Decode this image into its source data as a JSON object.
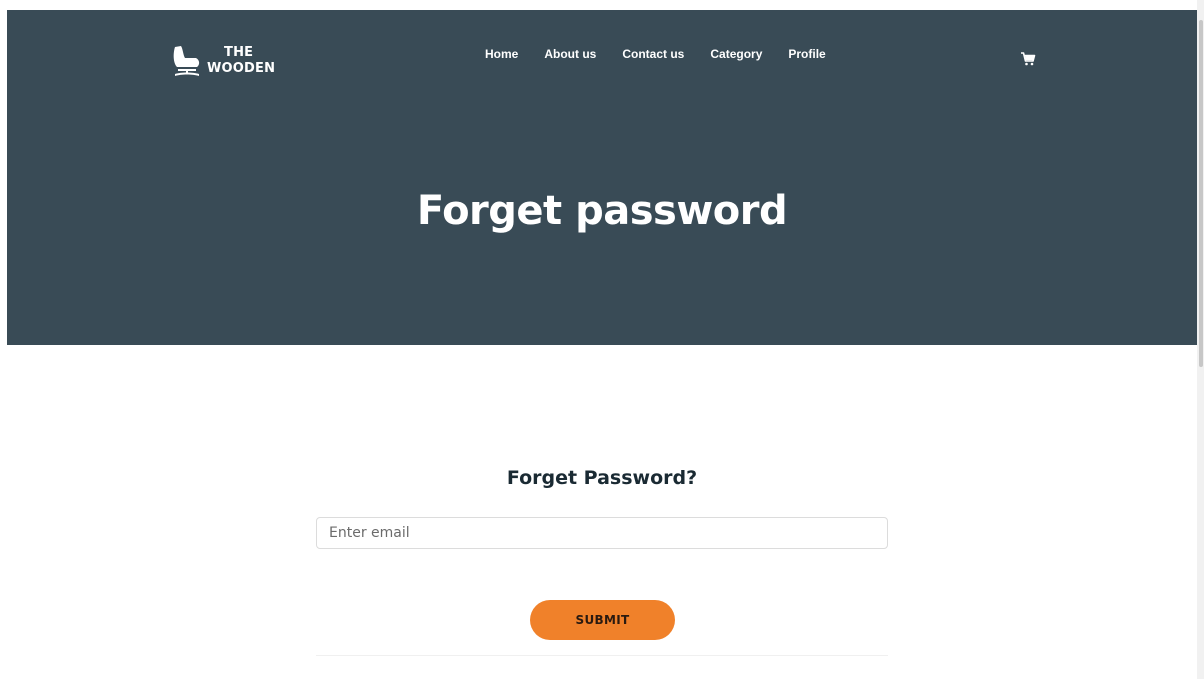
{
  "brand": {
    "line1": "THE",
    "line2": "WOODEN"
  },
  "nav": [
    "Home",
    "About us",
    "Contact us",
    "Category",
    "Profile"
  ],
  "hero": {
    "title": "Forget password"
  },
  "form": {
    "title": "Forget Password?",
    "email_placeholder": "Enter email",
    "email_value": "",
    "submit_label": "SUBMIT"
  },
  "icons": {
    "cart": "shopping-cart-icon",
    "logo": "chair-icon"
  },
  "colors": {
    "hero_bg": "#394b56",
    "accent": "#f0812a",
    "heading": "#1a2a33"
  }
}
